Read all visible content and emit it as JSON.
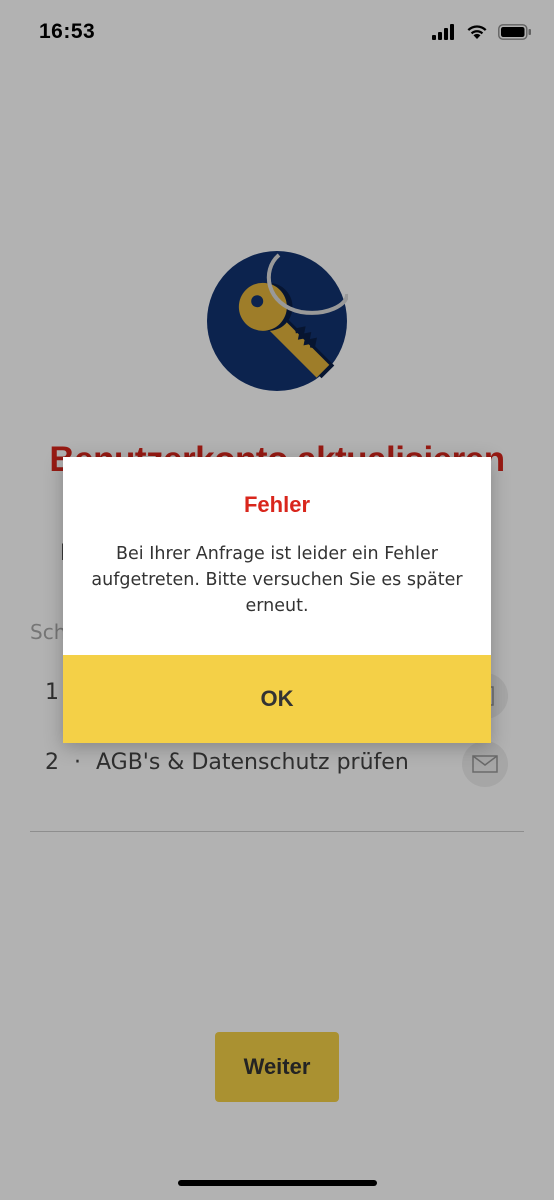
{
  "status_bar": {
    "time": "16:53",
    "icons": [
      "signal-icon",
      "wifi-icon",
      "battery-icon"
    ]
  },
  "page": {
    "title": "Benutzerkonto aktualisieren",
    "hidden_intro_letter": "I",
    "section_label": "Sch",
    "steps": [
      {
        "number": "1",
        "separator": "·",
        "label": "",
        "icon": "document-icon"
      },
      {
        "number": "2",
        "separator": "·",
        "label": "AGB's & Datenschutz prüfen",
        "icon": "mail-icon"
      }
    ],
    "continue_label": "Weiter"
  },
  "dialog": {
    "title": "Fehler",
    "message": "Bei Ihrer Anfrage ist leider ein Fehler aufgetreten. Bitte versuchen Sie es später erneut.",
    "ok_label": "OK"
  },
  "colors": {
    "accent_red": "#d9261c",
    "accent_yellow": "#f4d047",
    "hero_navy": "#123370",
    "key_gold": "#e3b43b",
    "overlay": "rgba(0,0,0,0.30)"
  }
}
